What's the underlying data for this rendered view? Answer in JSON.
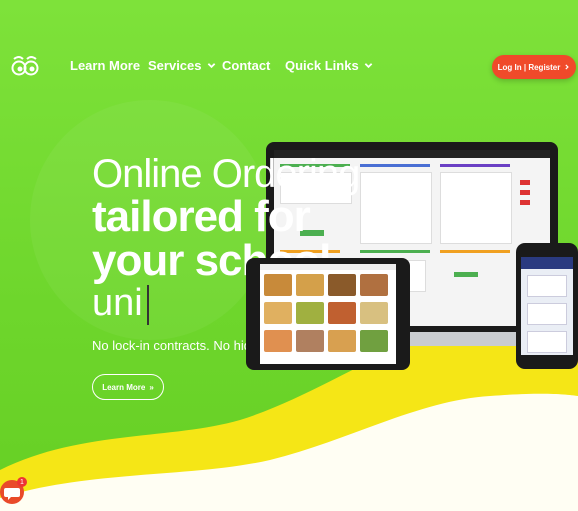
{
  "nav": {
    "logo_icon": "owl-eyes-icon",
    "links": [
      {
        "label": "Learn More"
      },
      {
        "label": "Services",
        "has_dropdown": true
      },
      {
        "label": "Contact"
      },
      {
        "label": "Quick Links",
        "has_dropdown": true
      }
    ],
    "login_label": "Log In | Register"
  },
  "hero": {
    "line1": "Online Ordering",
    "line2": "tailored for",
    "line3": "your school",
    "typed": "uni",
    "subtitle": "No lock-in contracts. No hidden na",
    "cta_label": "Learn More"
  },
  "chat": {
    "badge": "1"
  },
  "colors": {
    "background": "#7ee23a",
    "accent": "#f04a2a",
    "wave": "#f5e616"
  }
}
